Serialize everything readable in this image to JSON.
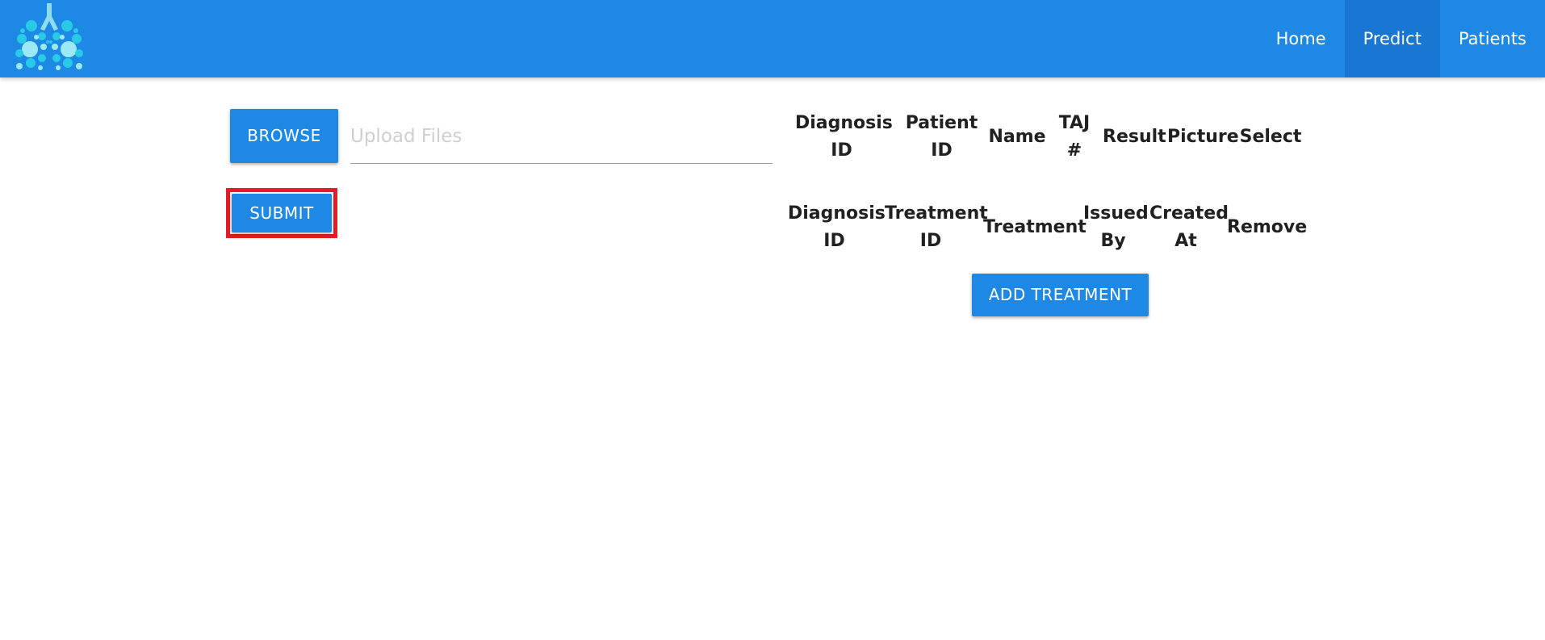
{
  "navbar": {
    "logo_alt": "lungs-logo",
    "links": [
      {
        "label": "Home"
      },
      {
        "label": "Predict",
        "active": true
      },
      {
        "label": "Patients"
      }
    ],
    "color": "#1e88e5",
    "active_color": "#1976d2"
  },
  "upload": {
    "browse_label": "BROWSE",
    "placeholder": "Upload Files",
    "value": "",
    "submit_label": "SUBMIT"
  },
  "diagnosis_table": {
    "headers": [
      {
        "line1": "Diagnosis",
        "line2": "ID"
      },
      {
        "line1": "Patient",
        "line2": "ID"
      },
      {
        "line1": "Name",
        "line2": ""
      },
      {
        "line1": "TAJ",
        "line2": "#"
      },
      {
        "line1": "Result",
        "line2": ""
      },
      {
        "line1": "Picture",
        "line2": ""
      },
      {
        "line1": "Select",
        "line2": ""
      }
    ],
    "rows": []
  },
  "treatment_table": {
    "headers": [
      {
        "line1": "Diagnosis",
        "line2": "ID"
      },
      {
        "line1": "Treatment",
        "line2": "ID"
      },
      {
        "line1": "Treatment",
        "line2": ""
      },
      {
        "line1": "Issued",
        "line2": "By"
      },
      {
        "line1": "Created",
        "line2": "At"
      },
      {
        "line1": "Remove",
        "line2": ""
      }
    ],
    "rows": []
  },
  "add_treatment_label": "ADD TREATMENT",
  "colors": {
    "primary": "#1e88e5",
    "highlight": "#e51c23"
  }
}
